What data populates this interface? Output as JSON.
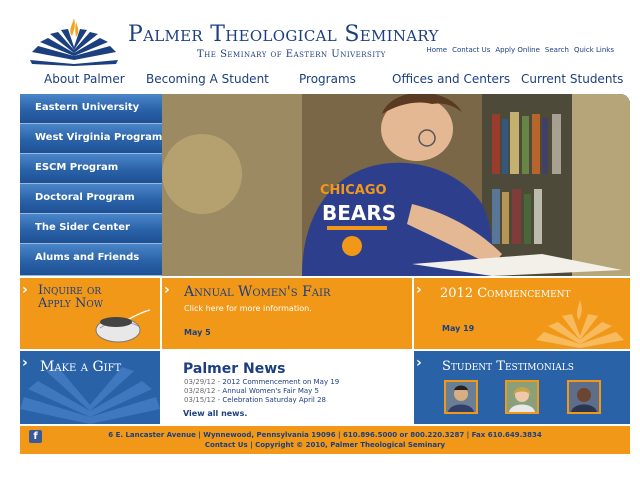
{
  "brand": {
    "title": "Palmer Theological Seminary",
    "subtitle": "The Seminary of Eastern University"
  },
  "utility_nav": [
    "Home",
    "Contact Us",
    "Apply Online",
    "Search",
    "Quick Links"
  ],
  "main_nav": [
    "About Palmer",
    "Becoming A Student",
    "Programs",
    "Offices and Centers",
    "Current Students"
  ],
  "sidebar": {
    "items": [
      {
        "label": "Eastern University"
      },
      {
        "label": "West Virginia Program"
      },
      {
        "label": "ESCM Program"
      },
      {
        "label": "Doctoral Program"
      },
      {
        "label": "The Sider Center"
      },
      {
        "label": "Alums and Friends"
      }
    ]
  },
  "hero": {
    "shirt_line1": "CHICAGO",
    "shirt_line2": "BEARS"
  },
  "inquire": {
    "line1": "Inquire or",
    "line2": "Apply Now"
  },
  "womens_fair": {
    "title": "Annual Women's Fair",
    "text": "Click here for more information.",
    "date": "May 5"
  },
  "commencement": {
    "title": "2012 Commencement",
    "date": "May 19"
  },
  "gift": {
    "title": "Make a Gift"
  },
  "news": {
    "title": "Palmer News",
    "items": [
      {
        "date": "03/29/12 - ",
        "text": "2012 Commencement on May 19"
      },
      {
        "date": "03/28/12 - ",
        "text": "Annual Women's Fair May 5"
      },
      {
        "date": "03/15/12 - ",
        "text": "Celebration Saturday April 28"
      }
    ],
    "view_all": "View all news."
  },
  "testimonials": {
    "title": "Student Testimonials"
  },
  "footer": {
    "fb_glyph": "f",
    "line1": "6 E. Lancaster Avenue | Wynnewood, Pennsylvania 19096 | 610.896.5000 or 800.220.3287 | Fax 610.649.3834",
    "line2": "Contact Us | Copyright © 2010, Palmer Theological Seminary"
  },
  "colors": {
    "brand_blue": "#1c3f80",
    "nav_blue": "#2a62a8",
    "orange": "#f29818"
  }
}
